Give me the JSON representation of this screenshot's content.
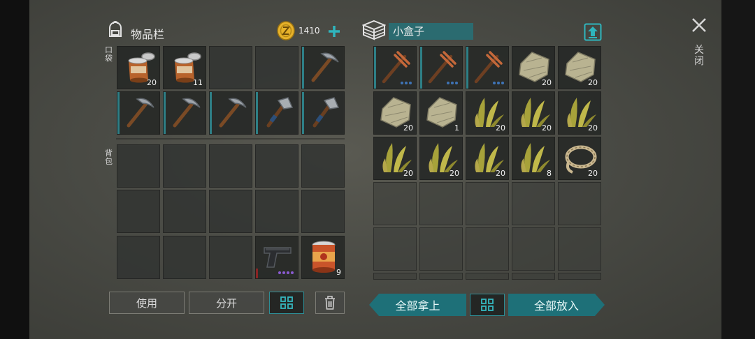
{
  "inventory": {
    "title": "物品栏",
    "coins": "1410",
    "section_pocket": "口袋",
    "section_backpack": "背包",
    "pocket_slots": [
      {
        "icon": "tin-can-icon",
        "count": "20"
      },
      {
        "icon": "tin-can-icon",
        "count": "11"
      },
      {
        "icon": "",
        "count": ""
      },
      {
        "icon": "",
        "count": ""
      },
      {
        "icon": "pickaxe-icon",
        "count": ""
      },
      {
        "icon": "pickaxe-icon",
        "count": ""
      },
      {
        "icon": "pickaxe-icon",
        "count": ""
      },
      {
        "icon": "pickaxe-icon",
        "count": ""
      },
      {
        "icon": "hatchet-icon",
        "count": ""
      },
      {
        "icon": "hatchet-icon",
        "count": ""
      }
    ],
    "backpack_slots": [
      {
        "icon": "",
        "count": ""
      },
      {
        "icon": "",
        "count": ""
      },
      {
        "icon": "",
        "count": ""
      },
      {
        "icon": "",
        "count": ""
      },
      {
        "icon": "",
        "count": ""
      },
      {
        "icon": "",
        "count": ""
      },
      {
        "icon": "",
        "count": ""
      },
      {
        "icon": "",
        "count": ""
      },
      {
        "icon": "",
        "count": ""
      },
      {
        "icon": "",
        "count": ""
      },
      {
        "icon": "",
        "count": ""
      },
      {
        "icon": "",
        "count": ""
      },
      {
        "icon": "",
        "count": ""
      },
      {
        "icon": "pistol-icon",
        "count": ""
      },
      {
        "icon": "food-can-icon",
        "count": "9"
      }
    ],
    "buttons": {
      "use": "使用",
      "split": "分开"
    }
  },
  "container": {
    "name": "小盒子",
    "slots": [
      {
        "icon": "copper-pickaxe-icon",
        "count": ""
      },
      {
        "icon": "copper-pickaxe-icon",
        "count": ""
      },
      {
        "icon": "copper-pickaxe-icon",
        "count": ""
      },
      {
        "icon": "cloth-icon",
        "count": "20"
      },
      {
        "icon": "cloth-icon",
        "count": "20"
      },
      {
        "icon": "cloth-icon",
        "count": "20"
      },
      {
        "icon": "cloth-icon",
        "count": "1"
      },
      {
        "icon": "plant-fiber-icon",
        "count": "20"
      },
      {
        "icon": "plant-fiber-icon",
        "count": "20"
      },
      {
        "icon": "plant-fiber-icon",
        "count": "20"
      },
      {
        "icon": "plant-fiber-icon",
        "count": "20"
      },
      {
        "icon": "plant-fiber-icon",
        "count": "20"
      },
      {
        "icon": "plant-fiber-icon",
        "count": "20"
      },
      {
        "icon": "plant-fiber-icon",
        "count": "8"
      },
      {
        "icon": "rope-icon",
        "count": "20"
      }
    ],
    "buttons": {
      "take_all": "全部拿上",
      "put_all": "全部放入"
    }
  },
  "close": {
    "label": "关闭"
  },
  "colors": {
    "accent": "#1f6f77",
    "accent_light": "#3aa9b1",
    "coin": "#e7b22a"
  }
}
